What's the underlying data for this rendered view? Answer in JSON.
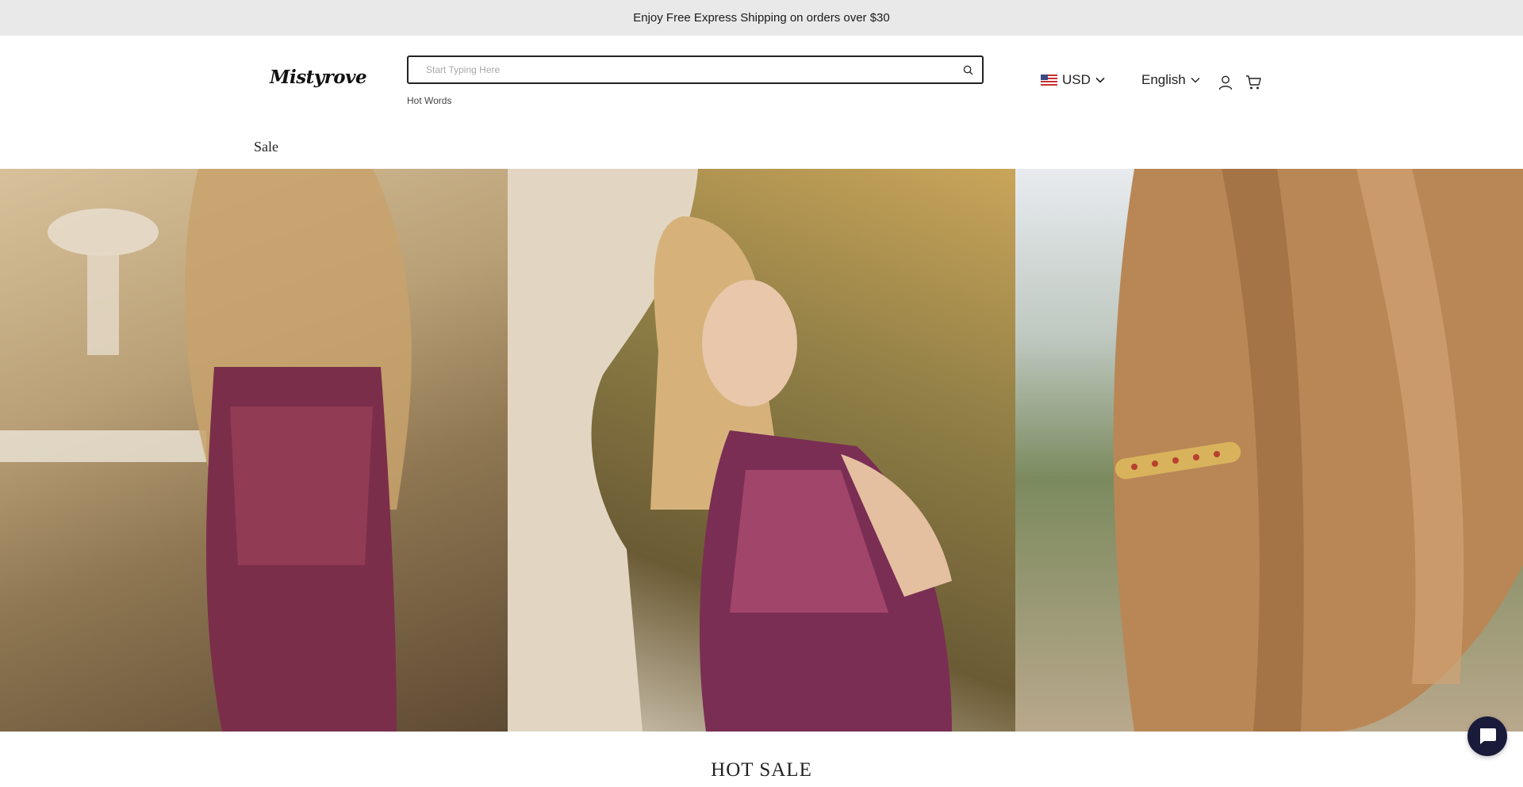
{
  "announcement": {
    "text": "Enjoy Free Express Shipping on orders over $30"
  },
  "header": {
    "logo_text": "Mistyrove",
    "search": {
      "placeholder": "Start Typing Here",
      "value": ""
    },
    "hot_words_label": "Hot Words",
    "currency": {
      "label": "USD",
      "flag_icon": "us-flag-icon"
    },
    "language": {
      "label": "English"
    },
    "icons": [
      "user-icon",
      "cart-icon",
      "search-icon",
      "chevron-down-icon"
    ]
  },
  "nav": {
    "items": [
      {
        "label": "Sale"
      }
    ]
  },
  "hero": {
    "panels": [
      {
        "name": "hero-image-model-back-view"
      },
      {
        "name": "hero-image-model-portrait"
      },
      {
        "name": "hero-image-hair-clip-closeup"
      }
    ]
  },
  "section": {
    "title": "HOT SALE"
  },
  "chat": {
    "icon": "chat-icon"
  },
  "colors": {
    "announcement_bg": "#e9e9e9",
    "chat_button": "#1a1b3a",
    "text": "#222222"
  }
}
